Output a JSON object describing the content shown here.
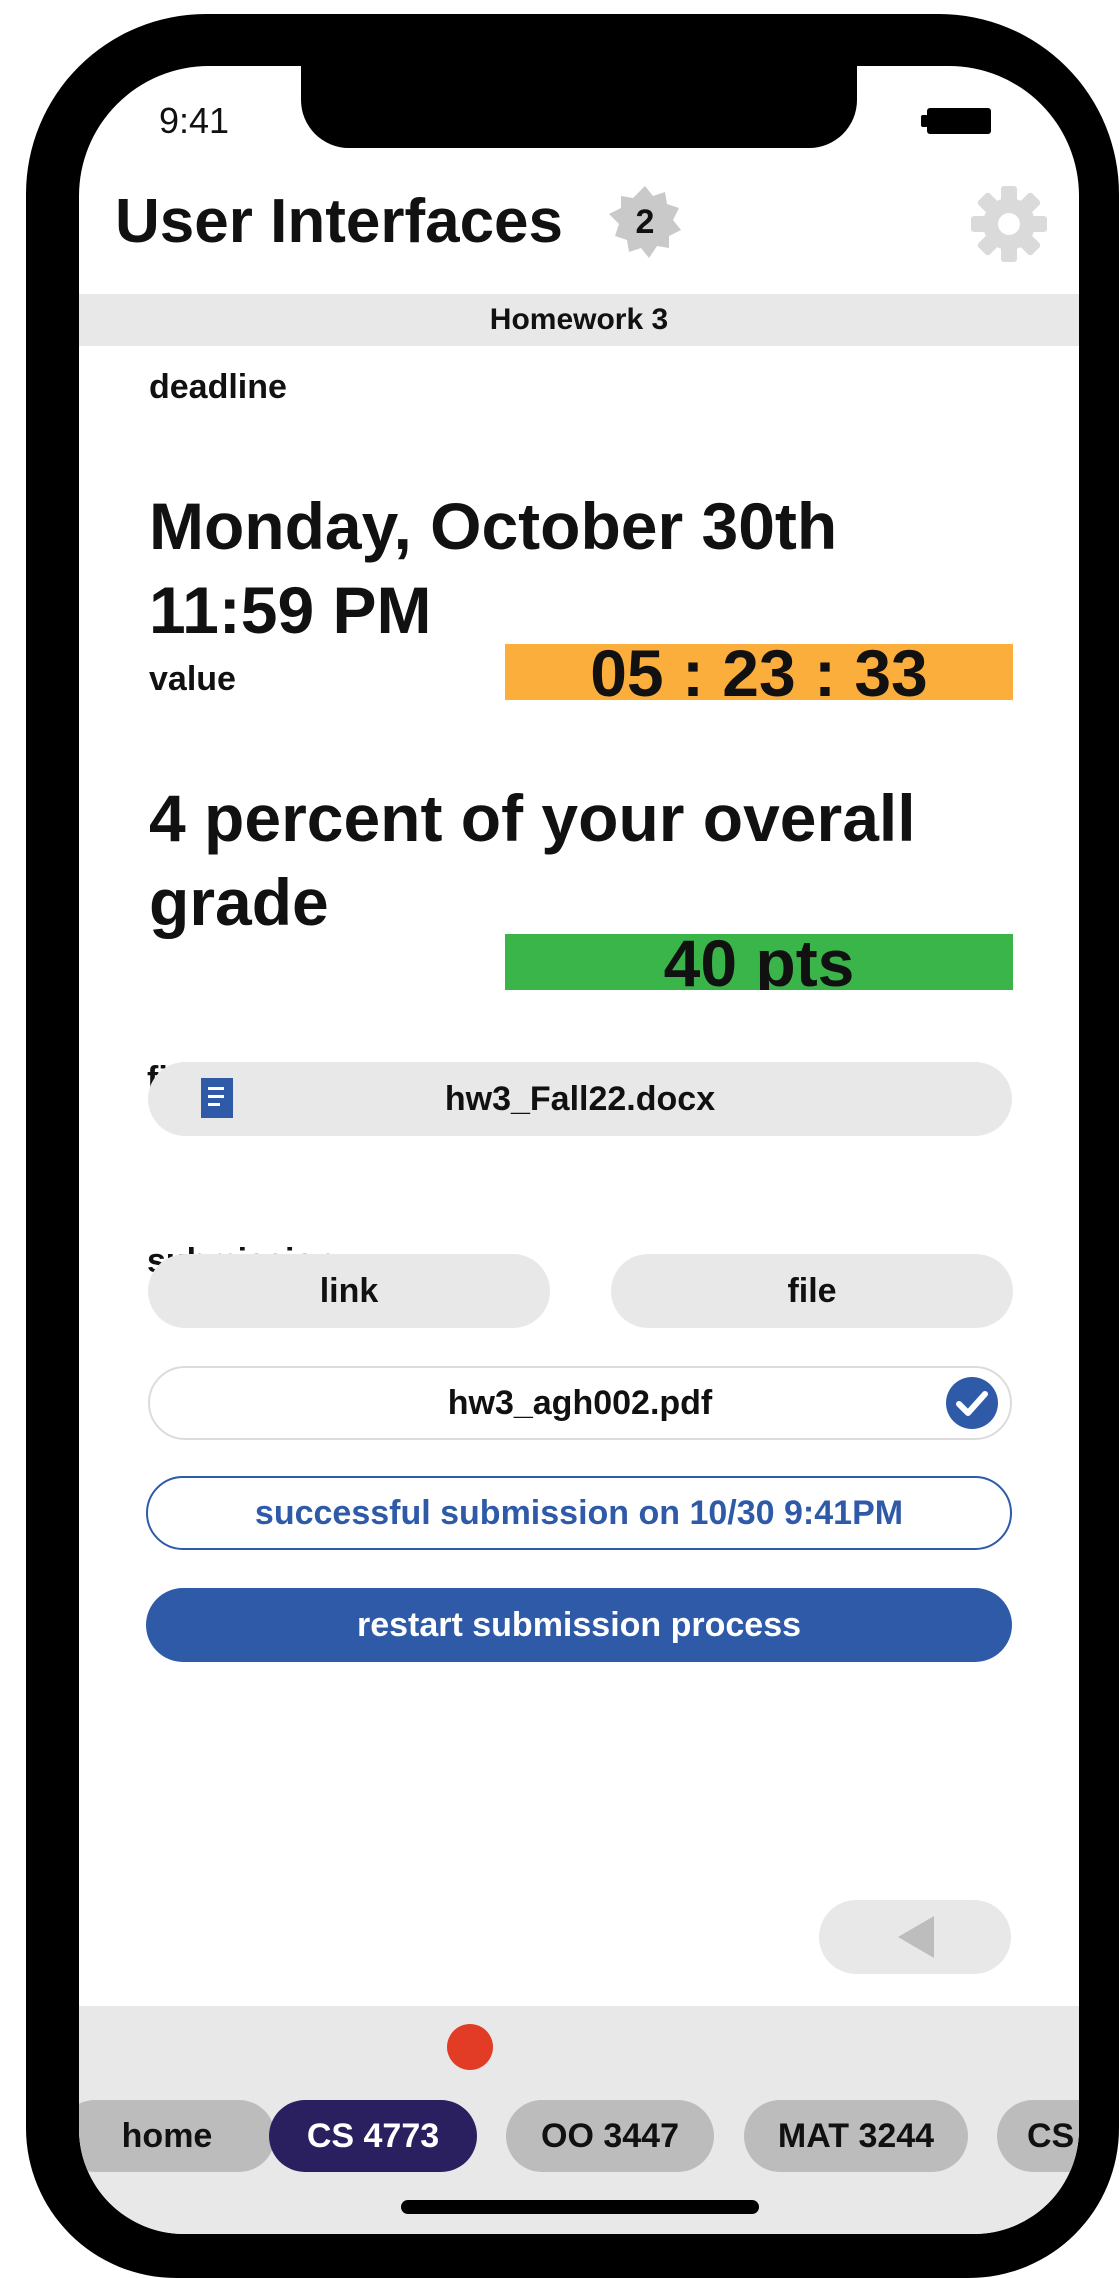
{
  "status_bar": {
    "time": "9:41"
  },
  "header": {
    "title": "User Interfaces",
    "badge_count": "2"
  },
  "subheader": {
    "title": "Homework 3"
  },
  "deadline": {
    "label": "deadline",
    "line1": "Monday, October 30th",
    "line2": "11:59 PM",
    "countdown": "05 : 23 : 33",
    "countdown_color": "#fbae3c"
  },
  "value": {
    "label": "value",
    "text": "4 percent of your overall grade",
    "points": "40 pts",
    "points_color": "#3ab54a"
  },
  "files": {
    "label": "files",
    "file_name": "hw3_Fall22.docx"
  },
  "submission": {
    "label": "submission",
    "link_button": "link",
    "file_button": "file",
    "submitted_file": "hw3_agh002.pdf",
    "status": "successful submission on 10/30 9:41PM",
    "restart_label": "restart submission process",
    "accent_color": "#2f5aa8"
  },
  "tabs": [
    {
      "label": "home"
    },
    {
      "label": "CS 4773"
    },
    {
      "label": "OO 3447"
    },
    {
      "label": "MAT 3244"
    },
    {
      "label": "CS"
    }
  ],
  "icons": [
    "battery-icon",
    "badge-icon",
    "gear-icon",
    "document-icon",
    "checkmark-icon",
    "back-arrow-icon"
  ]
}
